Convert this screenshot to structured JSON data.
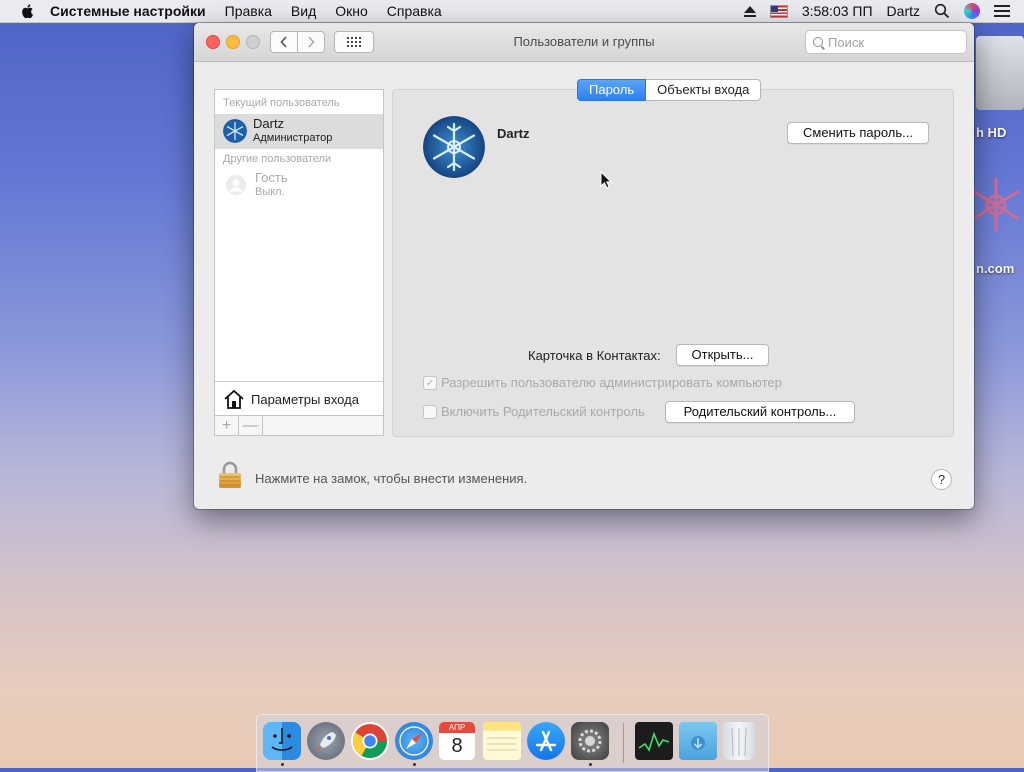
{
  "menubar": {
    "app_name": "Системные настройки",
    "items": [
      "Правка",
      "Вид",
      "Окно",
      "Справка"
    ],
    "clock": "3:58:03 ПП",
    "user": "Dartz"
  },
  "desktop": {
    "drive_label": "h HD",
    "site_label": "n.com"
  },
  "window": {
    "title": "Пользователи и группы",
    "search_placeholder": "Поиск",
    "tabs": [
      "Пароль",
      "Объекты входа"
    ],
    "list": {
      "current_header": "Текущий пользователь",
      "current_user": {
        "name": "Dartz",
        "role": "Администратор"
      },
      "other_header": "Другие пользователи",
      "other_user": {
        "name": "Гость",
        "role": "Выкл."
      },
      "login_options": "Параметры входа",
      "add": "+",
      "remove": "—"
    },
    "user_name": "Dartz",
    "change_password_button": "Сменить пароль...",
    "contacts_label": "Карточка в Контактах:",
    "open_button": "Открыть...",
    "allow_admin_label": "Разрешить пользователю администрировать компьютер",
    "parental_checkbox_label": "Включить Родительский контроль",
    "parental_button": "Родительский контроль...",
    "lock_text": "Нажмите на замок, чтобы внести изменения.",
    "help": "?"
  },
  "dock": {
    "apps": [
      "finder-icon",
      "launchpad-icon",
      "chrome-icon",
      "safari-icon",
      "calendar-icon",
      "notes-icon",
      "app-store-icon",
      "system-preferences-icon",
      "activity-monitor-icon",
      "downloads-folder-icon",
      "trash-icon"
    ],
    "calendar_month": "АПР",
    "calendar_day": "8"
  },
  "colors": {
    "accent": "#2f7ff0",
    "close": "#fc605c",
    "minimize": "#fdbc40"
  }
}
